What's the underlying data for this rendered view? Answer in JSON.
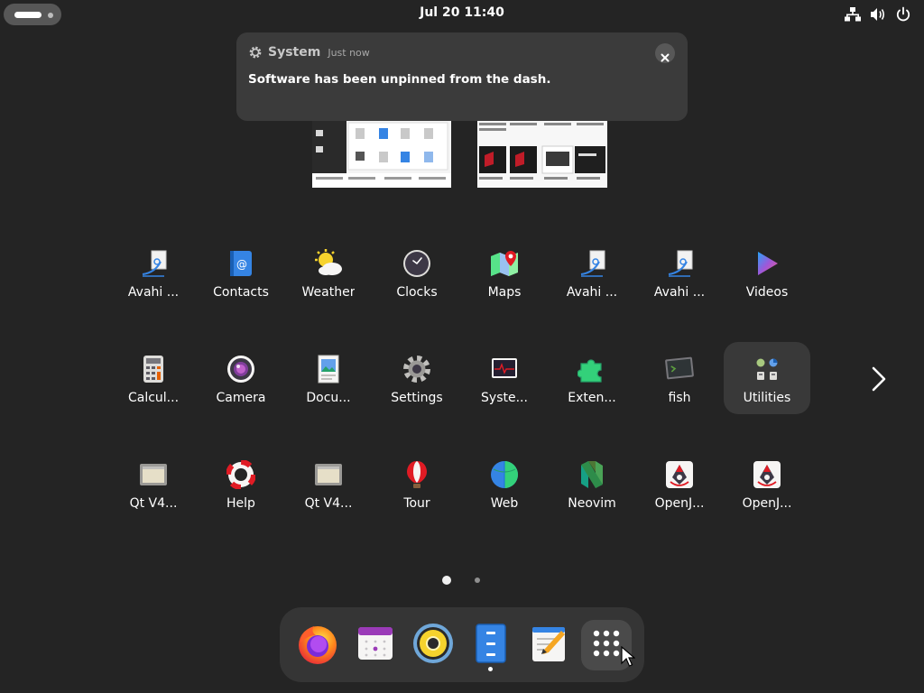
{
  "topbar": {
    "clock": "Jul 20  11:40",
    "tray_icons": [
      "network-wired-icon",
      "volume-icon",
      "power-icon"
    ]
  },
  "notification": {
    "app_name": "System",
    "time": "Just now",
    "message": "Software has been unpinned from the dash.",
    "close_icon": "close-icon"
  },
  "app_grid": {
    "rows": [
      [
        {
          "label": "Avahi ...",
          "icon": "avahi-icon"
        },
        {
          "label": "Contacts",
          "icon": "contacts-icon"
        },
        {
          "label": "Weather",
          "icon": "weather-icon"
        },
        {
          "label": "Clocks",
          "icon": "clocks-icon"
        },
        {
          "label": "Maps",
          "icon": "maps-icon"
        },
        {
          "label": "Avahi ...",
          "icon": "avahi-icon"
        },
        {
          "label": "Avahi ...",
          "icon": "avahi-icon"
        },
        {
          "label": "Videos",
          "icon": "videos-icon"
        }
      ],
      [
        {
          "label": "Calcul...",
          "icon": "calculator-icon"
        },
        {
          "label": "Camera",
          "icon": "camera-icon"
        },
        {
          "label": "Docu...",
          "icon": "document-viewer-icon"
        },
        {
          "label": "Settings",
          "icon": "settings-icon"
        },
        {
          "label": "Syste...",
          "icon": "system-monitor-icon"
        },
        {
          "label": "Exten...",
          "icon": "extensions-icon"
        },
        {
          "label": "fish",
          "icon": "terminal-icon"
        },
        {
          "label": "Utilities",
          "icon": "folder-icon"
        }
      ],
      [
        {
          "label": "Qt V4...",
          "icon": "qt-icon"
        },
        {
          "label": "Help",
          "icon": "help-icon"
        },
        {
          "label": "Qt V4...",
          "icon": "qt-icon"
        },
        {
          "label": "Tour",
          "icon": "tour-icon"
        },
        {
          "label": "Web",
          "icon": "web-icon"
        },
        {
          "label": "Neovim",
          "icon": "neovim-icon"
        },
        {
          "label": "OpenJ...",
          "icon": "java-icon"
        },
        {
          "label": "OpenJ...",
          "icon": "java-icon"
        }
      ]
    ],
    "highlighted": "Utilities",
    "page_count": 2,
    "current_page": 1
  },
  "dash": {
    "items": [
      {
        "icon": "firefox-icon"
      },
      {
        "icon": "calendar-icon"
      },
      {
        "icon": "rhythmbox-icon"
      },
      {
        "icon": "files-icon",
        "running": true
      },
      {
        "icon": "text-editor-icon"
      },
      {
        "icon": "show-apps-icon"
      }
    ]
  }
}
